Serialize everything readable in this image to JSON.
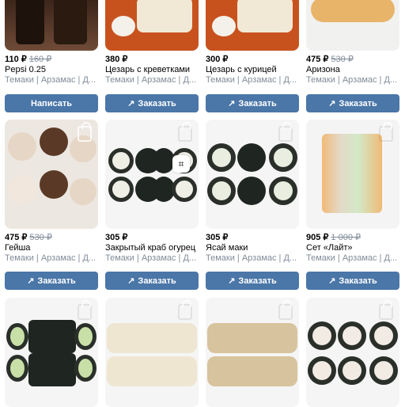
{
  "row1": [
    {
      "price": "110 ₽",
      "old_price": "160 ₽",
      "name": "Pepsi 0.25",
      "meta": "Темаки | Арзамас | Д...",
      "button": "Написать",
      "button_icon": ""
    },
    {
      "price": "380 ₽",
      "old_price": "",
      "name": "Цезарь с креветками",
      "meta": "Темаки | Арзамас | Д...",
      "button": "Заказать",
      "button_icon": "↗"
    },
    {
      "price": "300 ₽",
      "old_price": "",
      "name": "Цезарь с курицей",
      "meta": "Темаки | Арзамас | Д...",
      "button": "Заказать",
      "button_icon": "↗"
    },
    {
      "price": "475 ₽",
      "old_price": "530 ₽",
      "name": "Аризона",
      "meta": "Темаки | Арзамас | Д...",
      "button": "Заказать",
      "button_icon": "↗"
    }
  ],
  "row2": [
    {
      "price": "475 ₽",
      "old_price": "530 ₽",
      "name": "Гейша",
      "meta": "Темаки | Арзамас | Д...",
      "button": "Заказать",
      "button_icon": "↗"
    },
    {
      "price": "305 ₽",
      "old_price": "",
      "name": "Закрытый краб огурец",
      "meta": "Темаки | Арзамас | Д...",
      "button": "Заказать",
      "button_icon": "↗"
    },
    {
      "price": "305 ₽",
      "old_price": "",
      "name": "Ясай маки",
      "meta": "Темаки | Арзамас | Д...",
      "button": "Заказать",
      "button_icon": "↗"
    },
    {
      "price": "905 ₽",
      "old_price": "1 000 ₽",
      "name": "Сет «Лайт»",
      "meta": "Темаки | Арзамас | Д...",
      "button": "Заказать",
      "button_icon": "↗"
    }
  ],
  "colors": {
    "button": "#4a76a8",
    "muted": "#818c99"
  },
  "icons": {
    "button": "arrow-up-right-icon",
    "image_overlay": "shopping-bag-icon",
    "camera": "camera-scan-icon"
  }
}
